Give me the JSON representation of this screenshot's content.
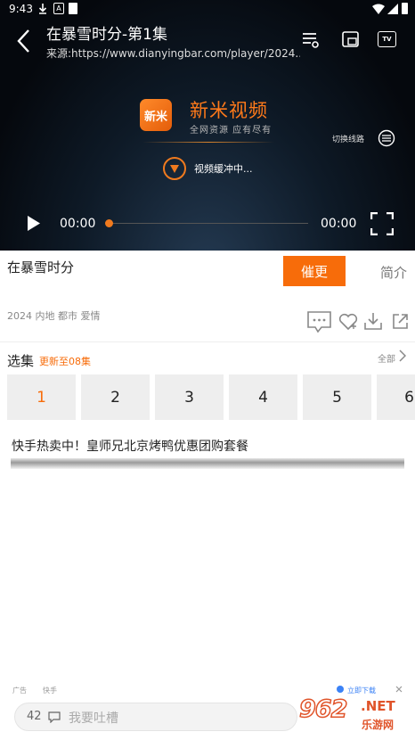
{
  "status_bar": {
    "time": "9:43",
    "notif_letter": "A"
  },
  "header": {
    "title": "在暴雪时分-第1集",
    "source": "来源:https://www.dianyingbar.com/player/2024...",
    "tv_label": "TV"
  },
  "player": {
    "logo_text": "新米",
    "brand": "新米视频",
    "slogan": "全网资源 应有尽有",
    "switch_line": "切换线路",
    "buffering": "视频缓冲中...",
    "current_time": "00:00",
    "total_time": "00:00",
    "progress": 0,
    "accent": "#f07a1e"
  },
  "info": {
    "title": "在暴雪时分",
    "cuigeng": "催更",
    "intro": "简介",
    "meta": "2024 内地 都市 爱情"
  },
  "episodes": {
    "label": "选集",
    "update": "更新至08集",
    "all": "全部",
    "items": [
      "1",
      "2",
      "3",
      "4",
      "5",
      "6"
    ],
    "selected": "1"
  },
  "ad": {
    "text": "快手热卖中！皇师兄北京烤鸭优惠团购套餐",
    "foot_left": "广告",
    "foot_brand": "快手",
    "download": "立即下载"
  },
  "comment": {
    "count": "42",
    "placeholder": "我要吐槽"
  },
  "watermark": {
    "num": "962",
    "net": ".NET",
    "sub": "乐游网"
  },
  "colors": {
    "primary": "#f76c0a"
  }
}
